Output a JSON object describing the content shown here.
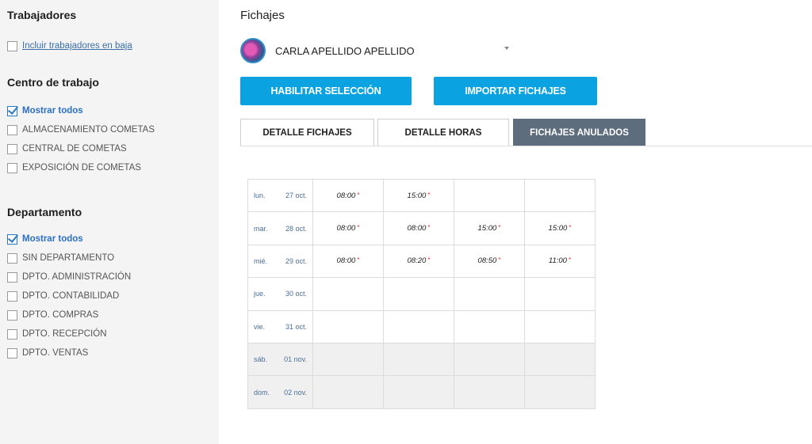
{
  "sidebar": {
    "workers_title": "Trabajadores",
    "include_inactive_label": "Incluir trabajadores en baja",
    "workcenter_title": "Centro de trabajo",
    "workcenter_items": [
      {
        "label": "Mostrar todos",
        "checked": true
      },
      {
        "label": "ALMACENAMIENTO COMETAS",
        "checked": false
      },
      {
        "label": "CENTRAL DE COMETAS",
        "checked": false
      },
      {
        "label": "EXPOSICIÓN DE COMETAS",
        "checked": false
      }
    ],
    "department_title": "Departamento",
    "department_items": [
      {
        "label": "Mostrar todos",
        "checked": true
      },
      {
        "label": "SIN DEPARTAMENTO",
        "checked": false
      },
      {
        "label": "DPTO. ADMINISTRACIÓN",
        "checked": false
      },
      {
        "label": "DPTO. CONTABILIDAD",
        "checked": false
      },
      {
        "label": "DPTO. COMPRAS",
        "checked": false
      },
      {
        "label": "DPTO. RECEPCIÓN",
        "checked": false
      },
      {
        "label": "DPTO. VENTAS",
        "checked": false
      }
    ]
  },
  "main": {
    "title": "Fichajes",
    "worker_name": "CARLA APELLIDO APELLIDO",
    "buttons": {
      "enable_selection": "HABILITAR SELECCIÓN",
      "import": "IMPORTAR FICHAJES"
    },
    "tabs": [
      {
        "label": "DETALLE FICHAJES"
      },
      {
        "label": "DETALLE HORAS"
      },
      {
        "label": "FICHAJES ANULADOS"
      }
    ],
    "rows": [
      {
        "day": "lun.",
        "date": "27 oct.",
        "slots": [
          "08:00",
          "15:00",
          "",
          ""
        ]
      },
      {
        "day": "mar.",
        "date": "28 oct.",
        "slots": [
          "08:00",
          "08:00",
          "15:00",
          "15:00"
        ]
      },
      {
        "day": "mié.",
        "date": "29 oct.",
        "slots": [
          "08:00",
          "08:20",
          "08:50",
          "11:00"
        ]
      },
      {
        "day": "jue.",
        "date": "30 oct.",
        "slots": [
          "",
          "",
          "",
          ""
        ]
      },
      {
        "day": "vie.",
        "date": "31 oct.",
        "slots": [
          "",
          "",
          "",
          ""
        ]
      },
      {
        "day": "sáb.",
        "date": "01 nov.",
        "slots": [
          "",
          "",
          "",
          ""
        ]
      },
      {
        "day": "dom.",
        "date": "02 nov.",
        "slots": [
          "",
          "",
          "",
          ""
        ]
      }
    ],
    "marker": "*"
  },
  "colors": {
    "accent": "#0aa2e0",
    "active_tab": "#5d6d7e",
    "checkbox": "#2b78c2",
    "marker": "#e53030"
  }
}
